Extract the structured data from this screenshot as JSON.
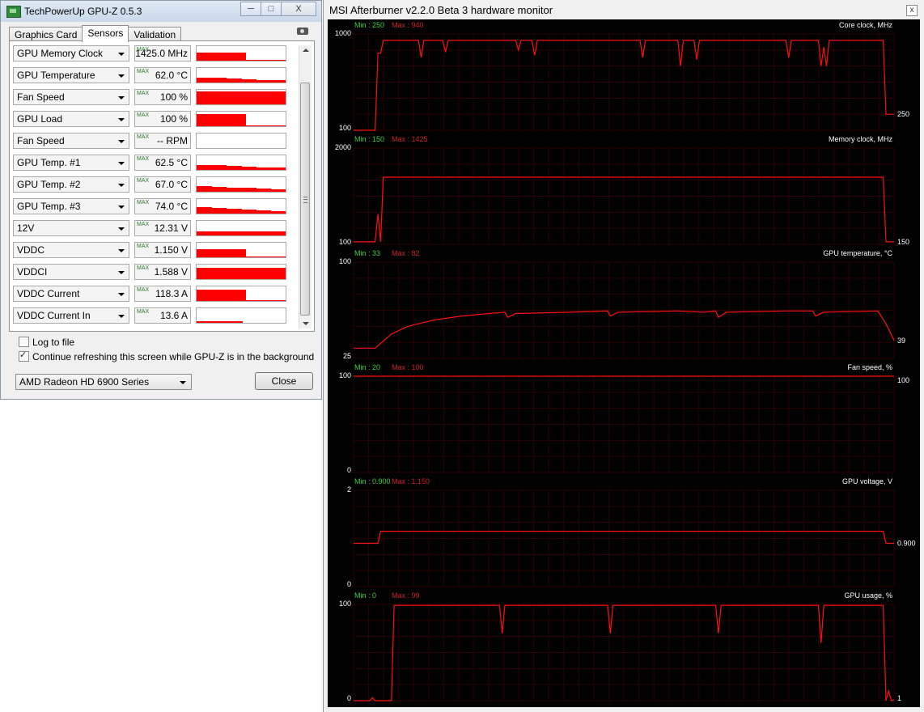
{
  "gpuz": {
    "title": "TechPowerUp GPU-Z 0.5.3",
    "window_buttons": {
      "minimize": "─",
      "maximize": "□",
      "close": "X"
    },
    "tabs": [
      "Graphics Card",
      "Sensors",
      "Validation"
    ],
    "active_tab": "Sensors",
    "max_tag": "MAX",
    "sensors": [
      {
        "name": "GPU Memory Clock",
        "value": "1425.0 MHz",
        "level": 0.55,
        "style": "block"
      },
      {
        "name": "GPU Temperature",
        "value": "62.0 °C",
        "level": 0.35,
        "style": "decay"
      },
      {
        "name": "Fan Speed",
        "value": "100 %",
        "level": 0.9,
        "style": "full"
      },
      {
        "name": "GPU Load",
        "value": "100 %",
        "level": 0.85,
        "style": "block"
      },
      {
        "name": "Fan Speed",
        "value": "-- RPM",
        "level": 0,
        "style": "none"
      },
      {
        "name": "GPU Temp. #1",
        "value": "62.5 °C",
        "level": 0.35,
        "style": "decay"
      },
      {
        "name": "GPU Temp. #2",
        "value": "67.0 °C",
        "level": 0.4,
        "style": "decay"
      },
      {
        "name": "GPU Temp. #3",
        "value": "74.0 °C",
        "level": 0.45,
        "style": "decay"
      },
      {
        "name": "12V",
        "value": "12.31 V",
        "level": 0.3,
        "style": "full"
      },
      {
        "name": "VDDC",
        "value": "1.150 V",
        "level": 0.55,
        "style": "block"
      },
      {
        "name": "VDDCI",
        "value": "1.588 V",
        "level": 0.8,
        "style": "full"
      },
      {
        "name": "VDDC Current",
        "value": "118.3 A",
        "level": 0.75,
        "style": "block"
      },
      {
        "name": "VDDC Current In",
        "value": "13.6 A",
        "level": 0.1,
        "style": "line"
      }
    ],
    "log_to_file": {
      "label": "Log to file",
      "checked": false
    },
    "continue_refresh": {
      "label": "Continue refreshing this screen while GPU-Z is in the background",
      "checked": true
    },
    "gpu_select": "AMD Radeon HD 6900 Series",
    "close_label": "Close"
  },
  "afterburner": {
    "title": "MSI Afterburner v2.2.0 Beta 3 hardware monitor",
    "close_glyph": "x",
    "graphs": [
      {
        "title": "Core clock, MHz",
        "min": "Min : 250",
        "max": "Max : 940",
        "ymax": "1000",
        "ymin": "100",
        "current": "250",
        "yrange": [
          100,
          1000
        ],
        "points": [
          [
            0,
            100
          ],
          [
            0.04,
            100
          ],
          [
            0.045,
            820
          ],
          [
            0.05,
            820
          ],
          [
            0.055,
            940
          ],
          [
            0.12,
            940
          ],
          [
            0.125,
            780
          ],
          [
            0.13,
            940
          ],
          [
            0.165,
            940
          ],
          [
            0.17,
            830
          ],
          [
            0.175,
            940
          ],
          [
            0.3,
            940
          ],
          [
            0.305,
            850
          ],
          [
            0.31,
            940
          ],
          [
            0.33,
            940
          ],
          [
            0.335,
            800
          ],
          [
            0.34,
            940
          ],
          [
            0.53,
            940
          ],
          [
            0.535,
            780
          ],
          [
            0.54,
            940
          ],
          [
            0.6,
            940
          ],
          [
            0.605,
            700
          ],
          [
            0.61,
            940
          ],
          [
            0.63,
            940
          ],
          [
            0.635,
            760
          ],
          [
            0.64,
            940
          ],
          [
            0.8,
            940
          ],
          [
            0.805,
            780
          ],
          [
            0.81,
            940
          ],
          [
            0.86,
            940
          ],
          [
            0.865,
            700
          ],
          [
            0.87,
            880
          ],
          [
            0.875,
            700
          ],
          [
            0.88,
            940
          ],
          [
            0.98,
            940
          ],
          [
            0.985,
            250
          ],
          [
            1,
            250
          ]
        ]
      },
      {
        "title": "Memory clock, MHz",
        "min": "Min : 150",
        "max": "Max : 1425",
        "ymax": "2000",
        "ymin": "100",
        "current": "150",
        "yrange": [
          100,
          2000
        ],
        "points": [
          [
            0,
            150
          ],
          [
            0.04,
            150
          ],
          [
            0.045,
            700
          ],
          [
            0.05,
            150
          ],
          [
            0.055,
            1425
          ],
          [
            0.98,
            1425
          ],
          [
            0.985,
            150
          ],
          [
            1,
            150
          ]
        ]
      },
      {
        "title": "GPU temperature, °C",
        "min": "Min : 33",
        "max": "Max : 82",
        "ymax": "100",
        "ymin": "25",
        "current": "39",
        "yrange": [
          25,
          100
        ],
        "points": [
          [
            0,
            33
          ],
          [
            0.04,
            33
          ],
          [
            0.07,
            44
          ],
          [
            0.1,
            50
          ],
          [
            0.15,
            55
          ],
          [
            0.2,
            58
          ],
          [
            0.25,
            60
          ],
          [
            0.28,
            61
          ],
          [
            0.285,
            57
          ],
          [
            0.3,
            60
          ],
          [
            0.4,
            61
          ],
          [
            0.47,
            62
          ],
          [
            0.475,
            58
          ],
          [
            0.49,
            61
          ],
          [
            0.6,
            62
          ],
          [
            0.65,
            61
          ],
          [
            0.67,
            62
          ],
          [
            0.675,
            57
          ],
          [
            0.69,
            61
          ],
          [
            0.8,
            62
          ],
          [
            0.85,
            62
          ],
          [
            0.855,
            58
          ],
          [
            0.87,
            61
          ],
          [
            0.97,
            62
          ],
          [
            0.985,
            52
          ],
          [
            1,
            39
          ]
        ]
      },
      {
        "title": "Fan speed, %",
        "min": "Min : 20",
        "max": "Max : 100",
        "ymax": "100",
        "ymin": "0",
        "current": "100",
        "yrange": [
          0,
          100
        ],
        "points": [
          [
            0,
            100
          ],
          [
            1,
            100
          ]
        ]
      },
      {
        "title": "GPU voltage, V",
        "min": "Min : 0.900",
        "max": "Max : 1.150",
        "ymax": "2",
        "ymin": "0",
        "current": "0.900",
        "yrange": [
          0,
          2
        ],
        "points": [
          [
            0,
            0.9
          ],
          [
            0.045,
            0.9
          ],
          [
            0.05,
            1.15
          ],
          [
            0.98,
            1.15
          ],
          [
            0.985,
            0.9
          ],
          [
            1,
            0.9
          ]
        ]
      },
      {
        "title": "GPU usage, %",
        "min": "Min : 0",
        "max": "Max : 99",
        "ymax": "100",
        "ymin": "0",
        "current": "1",
        "yrange": [
          0,
          100
        ],
        "points": [
          [
            0,
            0
          ],
          [
            0.03,
            0
          ],
          [
            0.035,
            3
          ],
          [
            0.04,
            0
          ],
          [
            0.07,
            0
          ],
          [
            0.075,
            99
          ],
          [
            0.27,
            99
          ],
          [
            0.275,
            70
          ],
          [
            0.28,
            99
          ],
          [
            0.47,
            99
          ],
          [
            0.475,
            70
          ],
          [
            0.48,
            99
          ],
          [
            0.67,
            99
          ],
          [
            0.675,
            70
          ],
          [
            0.68,
            99
          ],
          [
            0.86,
            99
          ],
          [
            0.865,
            60
          ],
          [
            0.87,
            99
          ],
          [
            0.98,
            99
          ],
          [
            0.985,
            0
          ],
          [
            0.99,
            10
          ],
          [
            0.995,
            0
          ],
          [
            1,
            1
          ]
        ]
      }
    ]
  }
}
